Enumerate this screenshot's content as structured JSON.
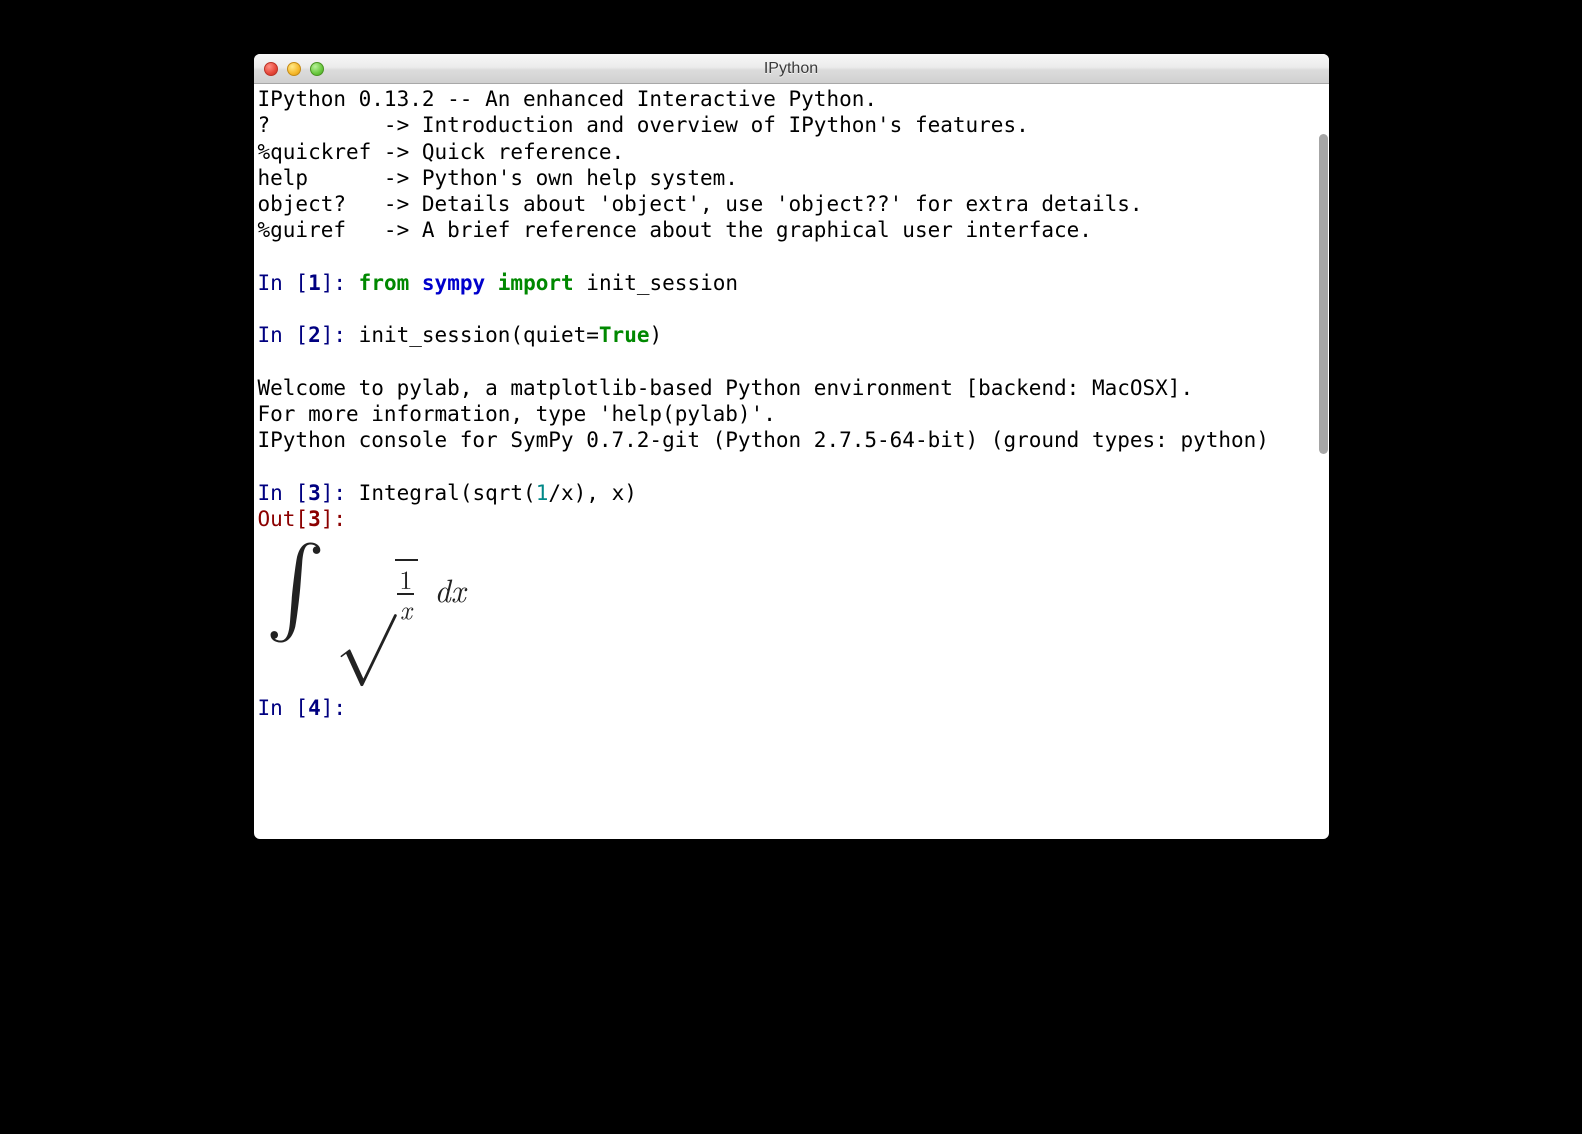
{
  "window": {
    "title": "IPython"
  },
  "banner": {
    "l1": "IPython 0.13.2 -- An enhanced Interactive Python.",
    "l2": "?         -> Introduction and overview of IPython's features.",
    "l3": "%quickref -> Quick reference.",
    "l4": "help      -> Python's own help system.",
    "l5": "object?   -> Details about 'object', use 'object??' for extra details.",
    "l6": "%guiref   -> A brief reference about the graphical user interface."
  },
  "prompts": {
    "in1": "In [",
    "n1": "1",
    "in1b": "]: ",
    "in2": "In [",
    "n2": "2",
    "in2b": "]: ",
    "in3": "In [",
    "n3": "3",
    "in3b": "]: ",
    "out3": "Out[",
    "o3": "3",
    "out3b": "]:",
    "in4": "In [",
    "n4": "4",
    "in4b": "]: "
  },
  "code1": {
    "kw_from": "from",
    "sp1": " ",
    "mod": "sympy",
    "sp2": " ",
    "kw_import": "import",
    "sp3": " ",
    "ident": "init_session"
  },
  "code2": {
    "call1": "init_session(quiet",
    "eq": "=",
    "true": "True",
    "call2": ")"
  },
  "pylab": {
    "l1": "Welcome to pylab, a matplotlib-based Python environment [backend: MacOSX].",
    "l2": "For more information, type 'help(pylab)'.",
    "l3": "IPython console for SymPy 0.7.2-git (Python 2.7.5-64-bit) (ground types: python)"
  },
  "code3": {
    "p1": "Integral(sqrt(",
    "num": "1",
    "slash": "/",
    "p2": "x), x)"
  },
  "math": {
    "integral": "∫",
    "radical": "√",
    "numerator": "1",
    "denominator": "x",
    "dx": "dx"
  }
}
